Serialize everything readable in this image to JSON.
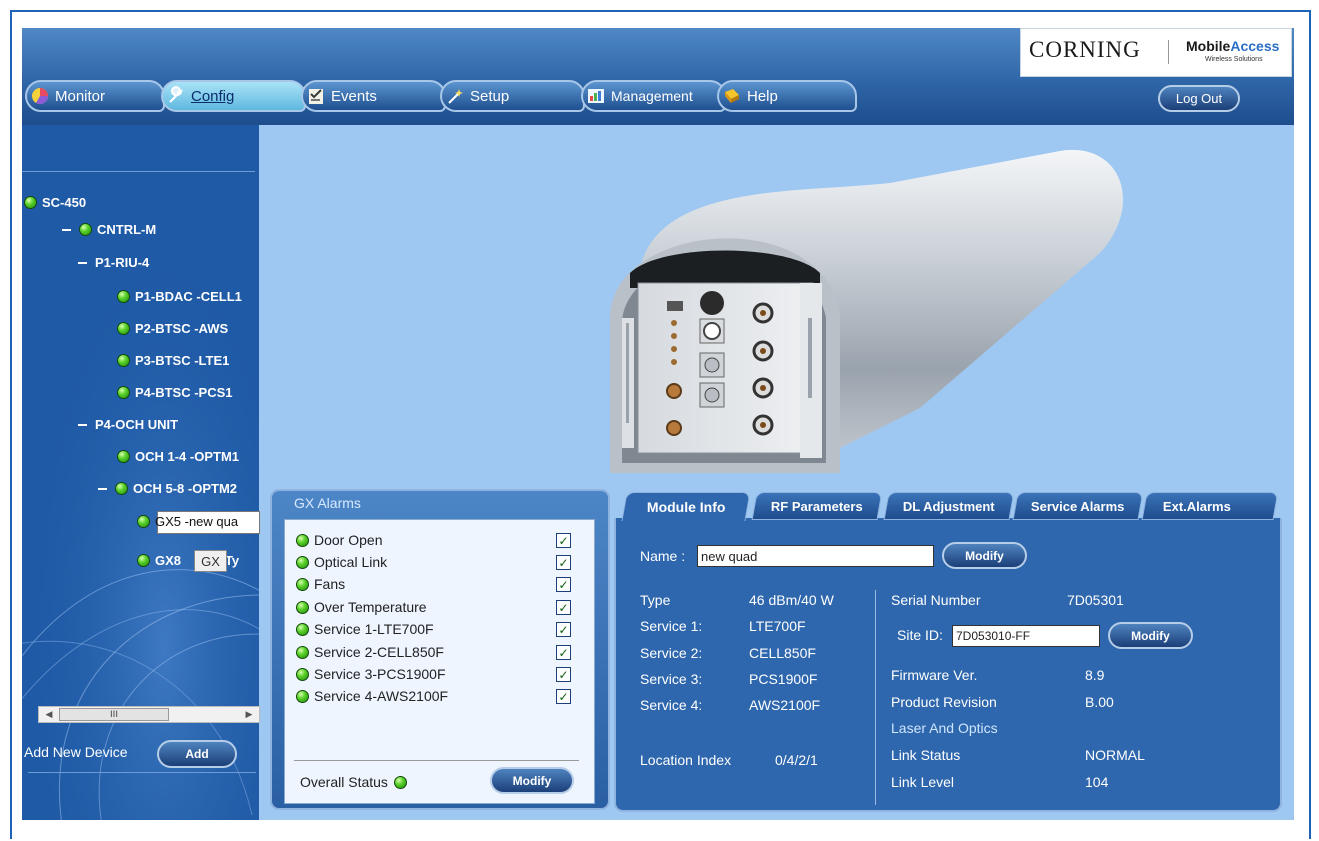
{
  "brand": {
    "corning": "CORNING",
    "mobile": "Mobile",
    "access": "Access",
    "tagline": "Wireless Solutions"
  },
  "nav": {
    "tabs": [
      {
        "label": "Monitor",
        "icon": "monitor-pie-icon"
      },
      {
        "label": "Config",
        "icon": "wrench-icon",
        "active": true
      },
      {
        "label": "Events",
        "icon": "events-checklist-icon"
      },
      {
        "label": "Setup",
        "icon": "magic-wand-icon"
      },
      {
        "label": "Management",
        "icon": "management-chart-icon"
      },
      {
        "label": "Help",
        "icon": "help-book-icon"
      }
    ],
    "logout": "Log Out"
  },
  "tree": {
    "items": [
      {
        "label": "SC-450"
      },
      {
        "label": "CNTRL-M"
      },
      {
        "label": "P1-RIU-4"
      },
      {
        "label": "P1-BDAC -CELL1"
      },
      {
        "label": "P2-BTSC -AWS"
      },
      {
        "label": "P3-BTSC -LTE1"
      },
      {
        "label": "P4-BTSC -PCS1"
      },
      {
        "label": "P4-OCH UNIT"
      },
      {
        "label": "OCH 1-4 -OPTM1"
      },
      {
        "label": "OCH 5-8 -OPTM2"
      },
      {
        "label": "GX5 -new qua"
      },
      {
        "label": "GX8"
      },
      {
        "label": "oTy"
      }
    ],
    "tooltip": "GX",
    "scroll_thumb": "III",
    "add_label": "Add New Device",
    "add_button": "Add"
  },
  "gx_alarms": {
    "title": "GX Alarms",
    "items": [
      {
        "label": "Door Open",
        "checked": "✓"
      },
      {
        "label": "Optical Link",
        "checked": "✓"
      },
      {
        "label": "Fans",
        "checked": "✓"
      },
      {
        "label": "Over Temperature",
        "checked": "✓"
      },
      {
        "label": "Service 1-LTE700F",
        "checked": "✓"
      },
      {
        "label": "Service 2-CELL850F",
        "checked": "✓"
      },
      {
        "label": "Service 3-PCS1900F",
        "checked": "✓"
      },
      {
        "label": "Service 4-AWS2100F",
        "checked": "✓"
      }
    ],
    "overall_label": "Overall Status",
    "modify": "Modify"
  },
  "info_tabs": [
    "Module Info",
    "RF Parameters",
    "DL Adjustment",
    "Service Alarms",
    "Ext.Alarms"
  ],
  "module_info": {
    "name_label": "Name :",
    "name_value": "new quad",
    "modify": "Modify",
    "left": [
      {
        "label": "Type",
        "value": "46 dBm/40 W"
      },
      {
        "label": "Service 1:",
        "value": "LTE700F"
      },
      {
        "label": "Service 2:",
        "value": "CELL850F"
      },
      {
        "label": "Service 3:",
        "value": "PCS1900F"
      },
      {
        "label": "Service 4:",
        "value": "AWS2100F"
      }
    ],
    "location_label": "Location Index",
    "location_value": "0/4/2/1",
    "serial_label": "Serial Number",
    "serial_value": "7D05301",
    "site_label": "Site ID:",
    "site_value": "7D053010-FF",
    "site_modify": "Modify",
    "firmware_label": "Firmware Ver.",
    "firmware_value": "8.9",
    "revision_label": "Product Revision",
    "revision_value": "B.00",
    "laser_header": "Laser And Optics",
    "link_status_label": "Link Status",
    "link_status_value": "NORMAL",
    "link_level_label": "Link Level",
    "link_level_value": "104"
  }
}
